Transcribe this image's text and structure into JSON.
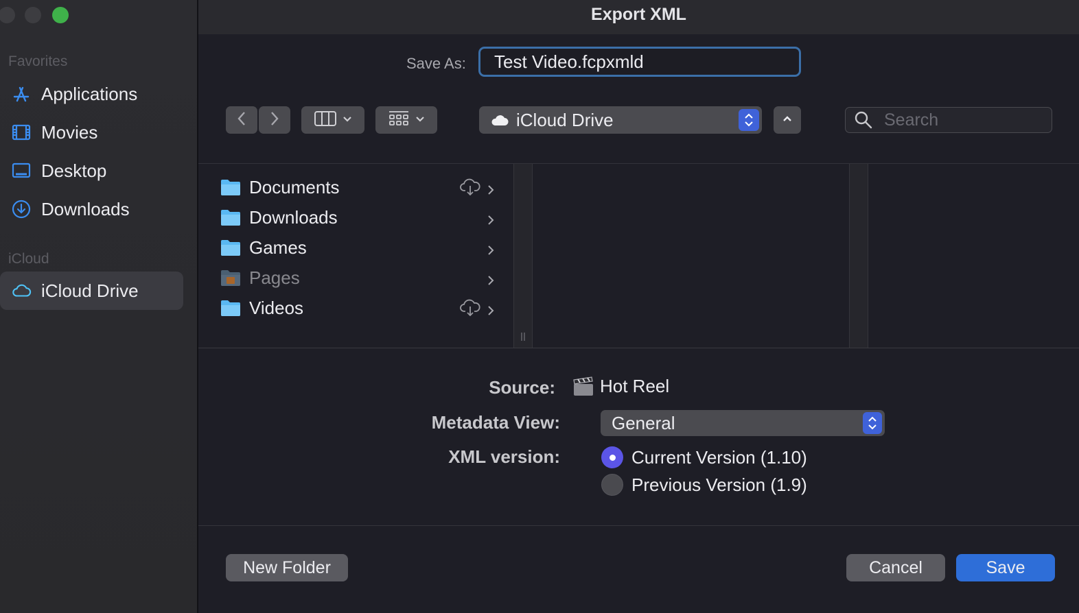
{
  "window": {
    "title": "Export XML"
  },
  "sidebar": {
    "favorites_header": "Favorites",
    "favorites": [
      {
        "label": "Applications",
        "icon": "applications-icon"
      },
      {
        "label": "Movies",
        "icon": "movies-icon"
      },
      {
        "label": "Desktop",
        "icon": "desktop-icon"
      },
      {
        "label": "Downloads",
        "icon": "downloads-icon"
      }
    ],
    "icloud_header": "iCloud",
    "icloud": [
      {
        "label": "iCloud Drive",
        "icon": "cloud-icon",
        "selected": true
      }
    ]
  },
  "save_as": {
    "label": "Save As:",
    "value": "Test Video.fcpxmld"
  },
  "toolbar": {
    "location": "iCloud Drive",
    "search_placeholder": "Search"
  },
  "files": [
    {
      "name": "Documents",
      "cloud": true,
      "dim": false
    },
    {
      "name": "Downloads",
      "cloud": false,
      "dim": false
    },
    {
      "name": "Games",
      "cloud": false,
      "dim": false
    },
    {
      "name": "Pages",
      "cloud": false,
      "dim": true
    },
    {
      "name": "Videos",
      "cloud": true,
      "dim": false
    }
  ],
  "options": {
    "source_label": "Source:",
    "source_value": "Hot Reel",
    "metadata_label": "Metadata View:",
    "metadata_value": "General",
    "xml_label": "XML version:",
    "xml_options": [
      {
        "label": "Current Version (1.10)",
        "selected": true
      },
      {
        "label": "Previous Version (1.9)",
        "selected": false
      }
    ]
  },
  "buttons": {
    "new_folder": "New Folder",
    "cancel": "Cancel",
    "save": "Save"
  },
  "colors": {
    "accent": "#2e6ed8",
    "stepper": "#3f62d9",
    "radio": "#5b55e6",
    "sidebar_icon": "#3b8df0"
  }
}
